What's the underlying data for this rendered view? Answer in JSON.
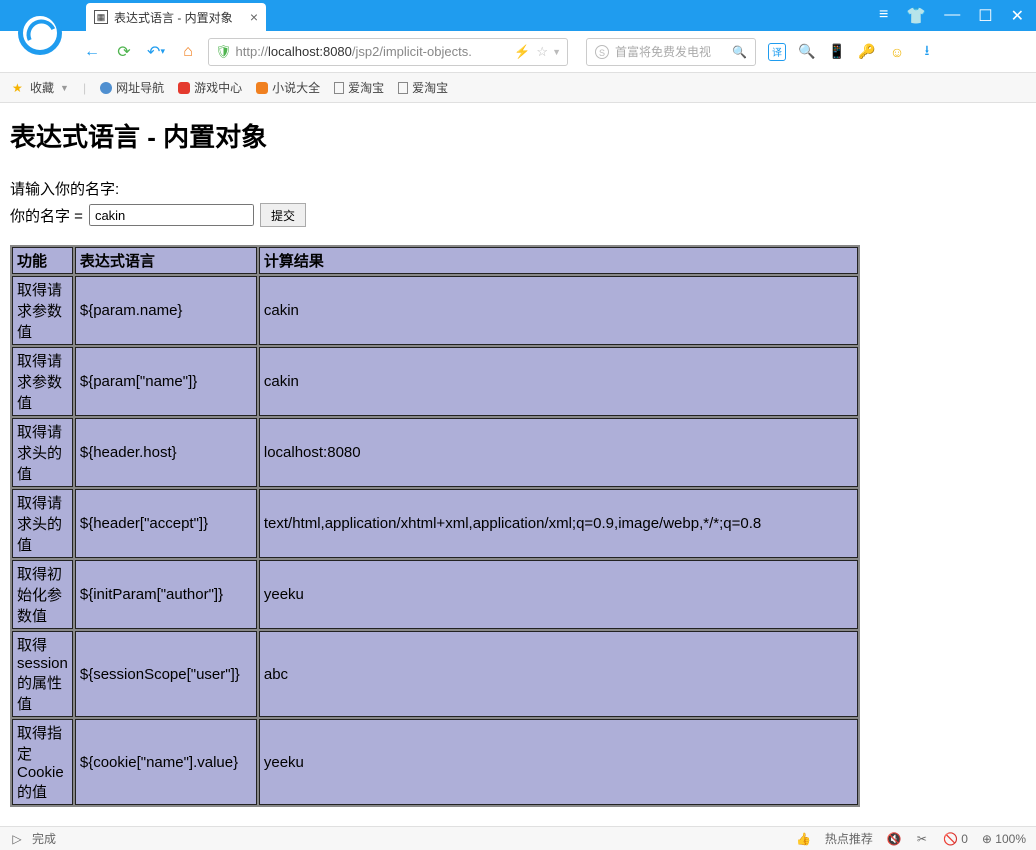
{
  "browser": {
    "tab_title": "表达式语言 - 内置对象",
    "url_pre": "http://",
    "url_host": "localhost:8080",
    "url_path": "/jsp2/implicit-objects.",
    "search_placeholder": "首富将免费发电视",
    "bookmarks_label": "收藏"
  },
  "bookmarks": [
    {
      "icon": "globe",
      "label": "网址导航"
    },
    {
      "icon": "red",
      "label": "游戏中心"
    },
    {
      "icon": "orange",
      "label": "小说大全"
    },
    {
      "icon": "file",
      "label": "爱淘宝"
    },
    {
      "icon": "file",
      "label": "爱淘宝"
    }
  ],
  "page": {
    "heading": "表达式语言 - 内置对象",
    "prompt": "请输入你的名字:",
    "name_label": "你的名字 =",
    "name_value": "cakin",
    "submit_label": "提交",
    "headers": [
      "功能",
      "表达式语言",
      "计算结果"
    ],
    "rows": [
      {
        "f": "取得请求参数值",
        "e": "${param.name}",
        "r": "cakin"
      },
      {
        "f": "取得请求参数值",
        "e": "${param[\"name\"]}",
        "r": "cakin"
      },
      {
        "f": "取得请求头的值",
        "e": "${header.host}",
        "r": "localhost:8080"
      },
      {
        "f": "取得请求头的值",
        "e": "${header[\"accept\"]}",
        "r": "text/html,application/xhtml+xml,application/xml;q=0.9,image/webp,*/*;q=0.8"
      },
      {
        "f": "取得初始化参数值",
        "e": "${initParam[\"author\"]}",
        "r": "yeeku"
      },
      {
        "f": "取得session的属性值",
        "e": "${sessionScope[\"user\"]}",
        "r": "abc"
      },
      {
        "f": "取得指定Cookie的值",
        "e": "${cookie[\"name\"].value}",
        "r": "yeeku"
      }
    ]
  },
  "statusbar": {
    "status": "完成",
    "hot": "热点推荐",
    "blocked": "0",
    "zoom": "100%"
  }
}
